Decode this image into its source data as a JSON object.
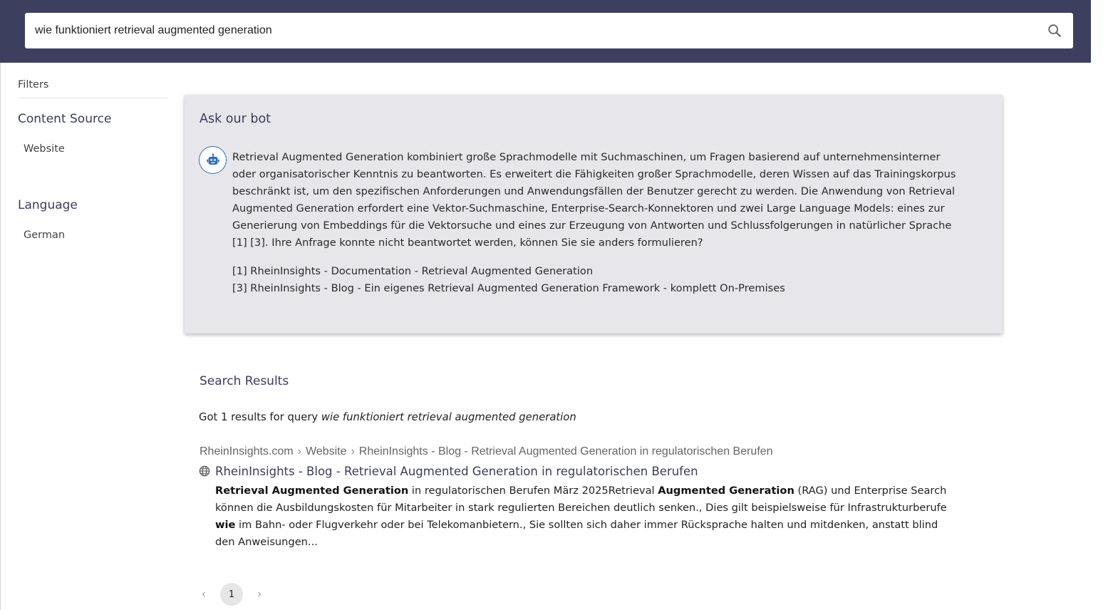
{
  "search": {
    "value": "wie funktioniert retrieval augmented generation"
  },
  "sidebar": {
    "filters_title": "Filters",
    "facets": [
      {
        "title": "Content Source",
        "items": [
          "Website"
        ]
      },
      {
        "title": "Language",
        "items": [
          "German"
        ]
      }
    ]
  },
  "bot": {
    "title": "Ask our bot",
    "answer": "Retrieval Augmented Generation kombiniert große Sprachmodelle mit Suchmaschinen, um Fragen basierend auf unternehmensinterner oder organisatorischer Kenntnis zu beantworten. Es erweitert die Fähigkeiten großer Sprachmodelle, deren Wissen auf das Trainingskorpus beschränkt ist, um den spezifischen Anforderungen und Anwendungsfällen der Benutzer gerecht zu werden. Die Anwendung von Retrieval Augmented Generation erfordert eine Vektor-Suchmaschine, Enterprise-Search-Konnektoren und zwei Large Language Models: eines zur Generierung von Embeddings für die Vektorsuche und eines zur Erzeugung von Antworten und Schlussfolgerungen in natürlicher Sprache [1] [3]. Ihre Anfrage konnte nicht beantwortet werden, können Sie sie anders formulieren?",
    "sources": [
      "[1] RheinInsights - Documentation - Retrieval Augmented Generation",
      "[3] RheinInsights - Blog - Ein eigenes Retrieval Augmented Generation Framework - komplett On-Premises"
    ]
  },
  "results": {
    "title": "Search Results",
    "summary_prefix": "Got 1 results for query ",
    "summary_query": "wie funktioniert retrieval augmented generation",
    "items": [
      {
        "breadcrumb": [
          "RheinInsights.com",
          "Website",
          "RheinInsights - Blog - Retrieval Augmented Generation in regulatorischen Berufen"
        ],
        "title": "RheinInsights - Blog - Retrieval Augmented Generation in regulatorischen Berufen",
        "snippet": [
          {
            "t": "Retrieval Augmented Generation",
            "b": true
          },
          {
            "t": " in regulatorischen Berufen März 2025Retrieval ",
            "b": false
          },
          {
            "t": "Augmented Generation",
            "b": true
          },
          {
            "t": " (RAG) und Enterprise Search können die Ausbildungskosten für Mitarbeiter in stark regulierten Bereichen deutlich senken., Dies gilt beispielsweise für Infrastrukturberufe ",
            "b": false
          },
          {
            "t": "wie",
            "b": true
          },
          {
            "t": " im Bahn- oder Flugverkehr oder bei Telekomanbietern., Sie sollten sich daher immer Rücksprache halten und mitdenken, anstatt blind den Anweisungen...",
            "b": false
          }
        ]
      }
    ]
  },
  "pagination": {
    "prev": "‹",
    "current": "1",
    "next": "›"
  }
}
